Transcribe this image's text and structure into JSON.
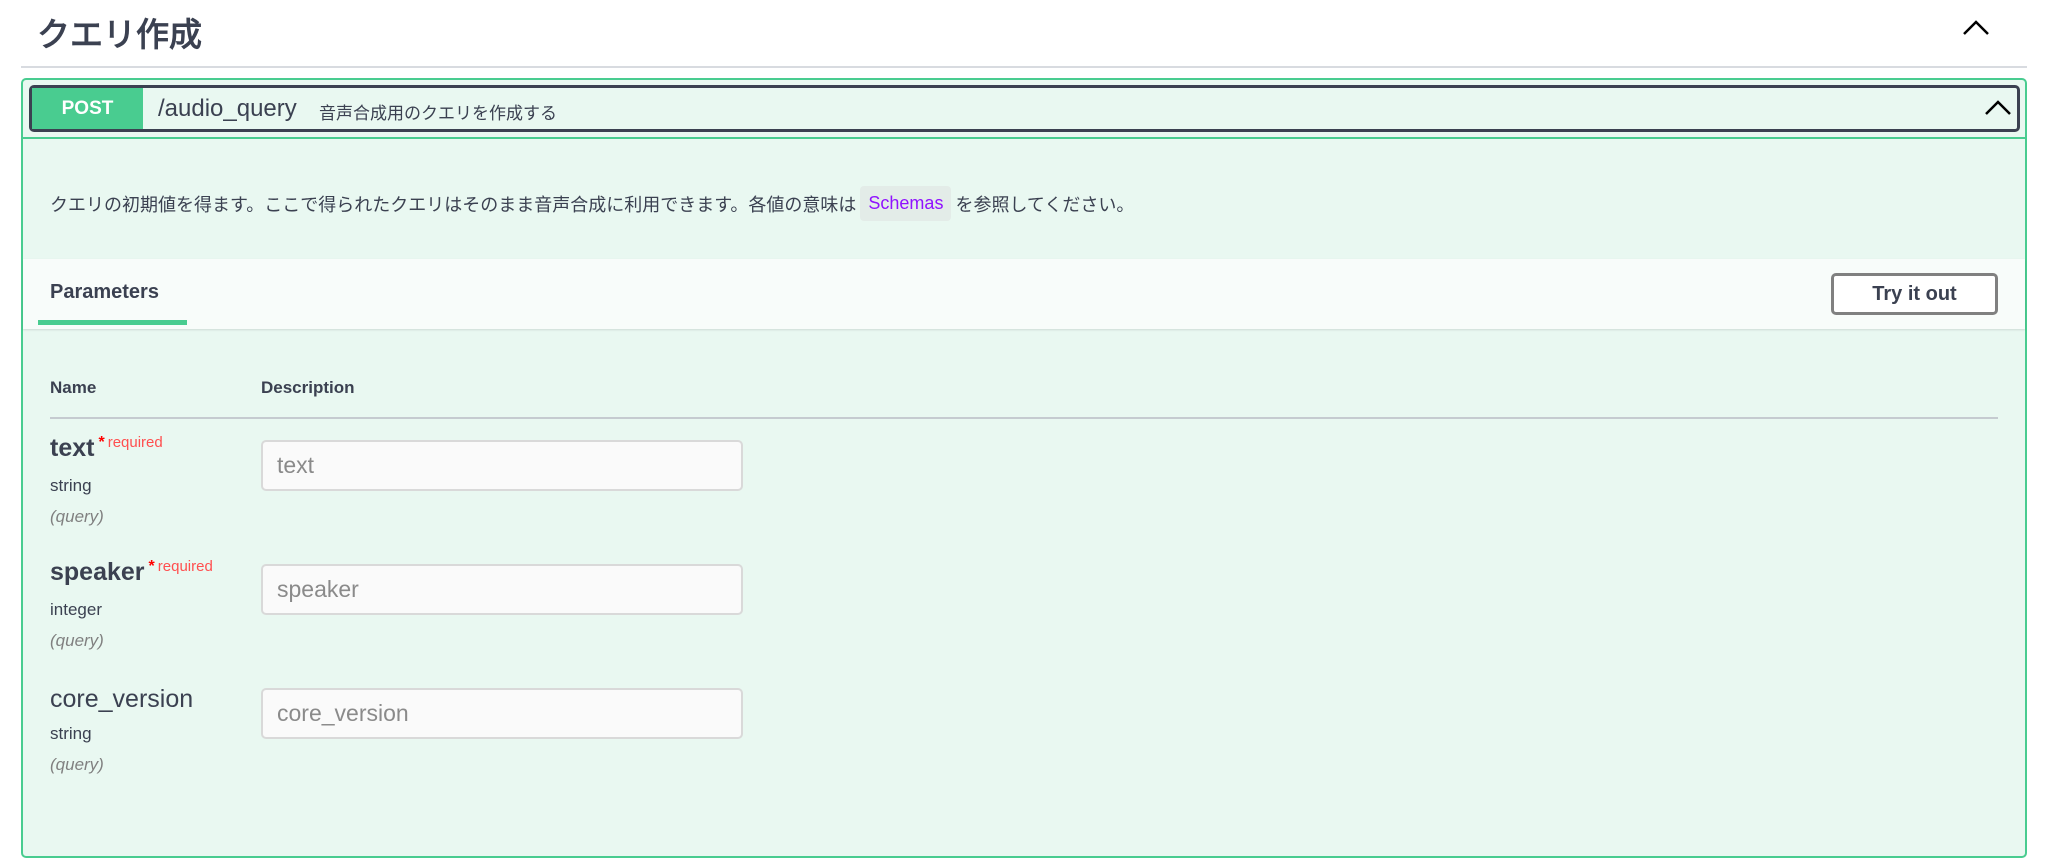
{
  "section": {
    "title": "クエリ作成"
  },
  "operation": {
    "method": "POST",
    "path": "/audio_query",
    "summary": "音声合成用のクエリを作成する",
    "description_before": "クエリの初期値を得ます。ここで得られたクエリはそのまま音声合成に利用できます。各値の意味は",
    "schemas_link": "Schemas",
    "description_after": "を参照してください。"
  },
  "tabs": {
    "parameters": "Parameters",
    "try_it_out": "Try it out"
  },
  "table": {
    "col_name": "Name",
    "col_description": "Description"
  },
  "parameters": [
    {
      "name": "text",
      "required": "required",
      "star": "*",
      "type": "string",
      "in": "(query)",
      "placeholder": "text"
    },
    {
      "name": "speaker",
      "required": "required",
      "star": "*",
      "type": "integer",
      "in": "(query)",
      "placeholder": "speaker"
    },
    {
      "name": "core_version",
      "type": "string",
      "in": "(query)",
      "placeholder": "core_version"
    }
  ],
  "colors": {
    "accent": "#49cc90",
    "text": "#3b4151",
    "required": "#ff0000",
    "link": "#9012fe"
  }
}
